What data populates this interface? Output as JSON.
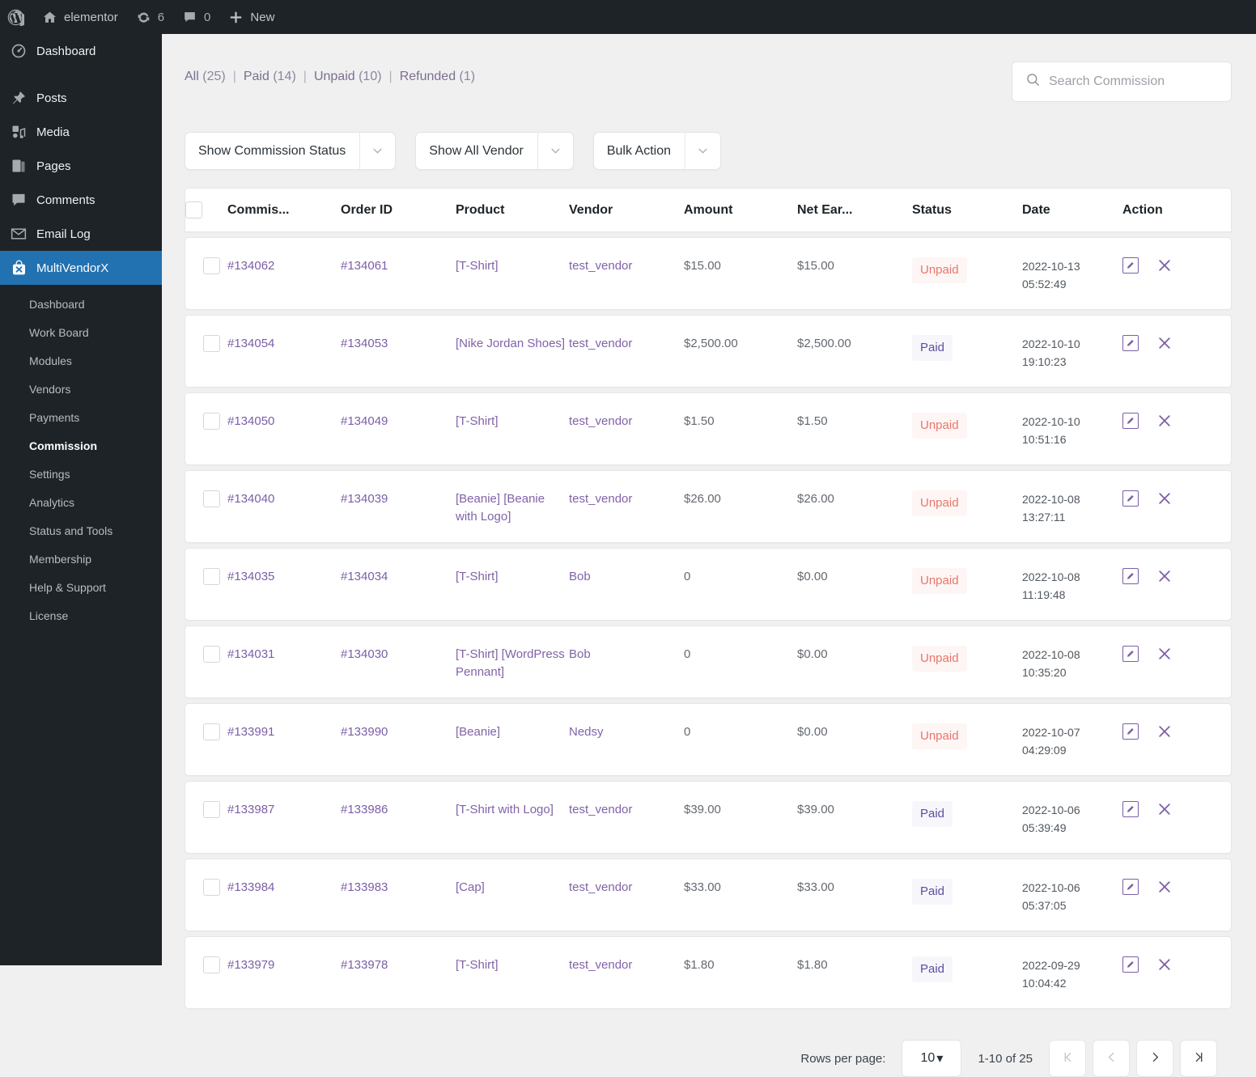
{
  "adminbar": {
    "logo_icon": "wordpress-icon",
    "site_icon": "home-icon",
    "site_name": "elementor",
    "updates_icon": "updates-icon",
    "updates_count": "6",
    "comments_icon": "comment-bubble-icon",
    "comments_count": "0",
    "new_icon": "plus-icon",
    "new_label": "New"
  },
  "sidebar": {
    "top_items": [
      {
        "label": "Dashboard",
        "icon": "dashboard-icon"
      },
      {
        "label": "Posts",
        "icon": "pin-icon"
      },
      {
        "label": "Media",
        "icon": "media-icon"
      },
      {
        "label": "Pages",
        "icon": "pages-icon"
      },
      {
        "label": "Comments",
        "icon": "comment-bubble-icon"
      },
      {
        "label": "Email Log",
        "icon": "envelope-icon"
      },
      {
        "label": "MultiVendorX",
        "icon": "multivendorx-bag-icon"
      }
    ],
    "submenu": [
      "Dashboard",
      "Work Board",
      "Modules",
      "Vendors",
      "Payments",
      "Commission",
      "Settings",
      "Analytics",
      "Status and Tools",
      "Membership",
      "Help & Support",
      "License"
    ],
    "active_top": "MultiVendorX",
    "active_sub": "Commission"
  },
  "status_links": [
    {
      "label": "All",
      "count": "(25)"
    },
    {
      "label": "Paid",
      "count": "(14)"
    },
    {
      "label": "Unpaid",
      "count": "(10)"
    },
    {
      "label": "Refunded",
      "count": "(1)"
    }
  ],
  "search": {
    "icon": "search-icon",
    "placeholder": "Search Commission",
    "value": ""
  },
  "filters": [
    {
      "label": "Show Commission Status",
      "icon": "chevron-down-icon"
    },
    {
      "label": "Show All Vendor",
      "icon": "chevron-down-icon"
    },
    {
      "label": "Bulk Action",
      "icon": "chevron-down-icon"
    }
  ],
  "table": {
    "columns": [
      "Commis...",
      "Order ID",
      "Product",
      "Vendor",
      "Amount",
      "Net Ear...",
      "Status",
      "Date",
      "Action"
    ],
    "rows": [
      {
        "commission": "#134062",
        "order": "#134061",
        "product": "[T-Shirt]",
        "vendor": "test_vendor",
        "amount": "$15.00",
        "net": "$15.00",
        "status": "Unpaid",
        "date": "2022-10-13",
        "time": "05:52:49"
      },
      {
        "commission": "#134054",
        "order": "#134053",
        "product": "[Nike Jordan Shoes]",
        "vendor": "test_vendor",
        "amount": "$2,500.00",
        "net": "$2,500.00",
        "status": "Paid",
        "date": "2022-10-10",
        "time": "19:10:23"
      },
      {
        "commission": "#134050",
        "order": "#134049",
        "product": "[T-Shirt]",
        "vendor": "test_vendor",
        "amount": "$1.50",
        "net": "$1.50",
        "status": "Unpaid",
        "date": "2022-10-10",
        "time": "10:51:16"
      },
      {
        "commission": "#134040",
        "order": "#134039",
        "product": "[Beanie] [Beanie with Logo]",
        "vendor": "test_vendor",
        "amount": "$26.00",
        "net": "$26.00",
        "status": "Unpaid",
        "date": "2022-10-08",
        "time": "13:27:11"
      },
      {
        "commission": "#134035",
        "order": "#134034",
        "product": "[T-Shirt]",
        "vendor": "Bob",
        "amount": "0",
        "net": "$0.00",
        "status": "Unpaid",
        "date": "2022-10-08",
        "time": "11:19:48"
      },
      {
        "commission": "#134031",
        "order": "#134030",
        "product": "[T-Shirt] [WordPress Pennant]",
        "vendor": "Bob",
        "amount": "0",
        "net": "$0.00",
        "status": "Unpaid",
        "date": "2022-10-08",
        "time": "10:35:20"
      },
      {
        "commission": "#133991",
        "order": "#133990",
        "product": "[Beanie]",
        "vendor": "Nedsy",
        "amount": "0",
        "net": "$0.00",
        "status": "Unpaid",
        "date": "2022-10-07",
        "time": "04:29:09"
      },
      {
        "commission": "#133987",
        "order": "#133986",
        "product": "[T-Shirt with Logo]",
        "vendor": "test_vendor",
        "amount": "$39.00",
        "net": "$39.00",
        "status": "Paid",
        "date": "2022-10-06",
        "time": "05:39:49"
      },
      {
        "commission": "#133984",
        "order": "#133983",
        "product": "[Cap]",
        "vendor": "test_vendor",
        "amount": "$33.00",
        "net": "$33.00",
        "status": "Paid",
        "date": "2022-10-06",
        "time": "05:37:05"
      },
      {
        "commission": "#133979",
        "order": "#133978",
        "product": "[T-Shirt]",
        "vendor": "test_vendor",
        "amount": "$1.80",
        "net": "$1.80",
        "status": "Paid",
        "date": "2022-09-29",
        "time": "10:04:42"
      }
    ],
    "row_action_edit_icon": "edit-pencil-icon",
    "row_action_delete_icon": "close-x-icon"
  },
  "pagination": {
    "rows_per_page_label": "Rows per page:",
    "rows_per_page_value": "10",
    "range": "1-10 of 25",
    "first_icon": "first-page-icon",
    "prev_icon": "previous-page-icon",
    "next_icon": "next-page-icon",
    "last_icon": "last-page-icon"
  },
  "colors": {
    "admin_bg": "#1d2327",
    "accent_blue": "#2271b1",
    "content_bg": "#f0f0f1",
    "link_purple": "#7b5ea7",
    "status_unpaid": "#e8766a",
    "status_paid": "#5b4f9e"
  }
}
